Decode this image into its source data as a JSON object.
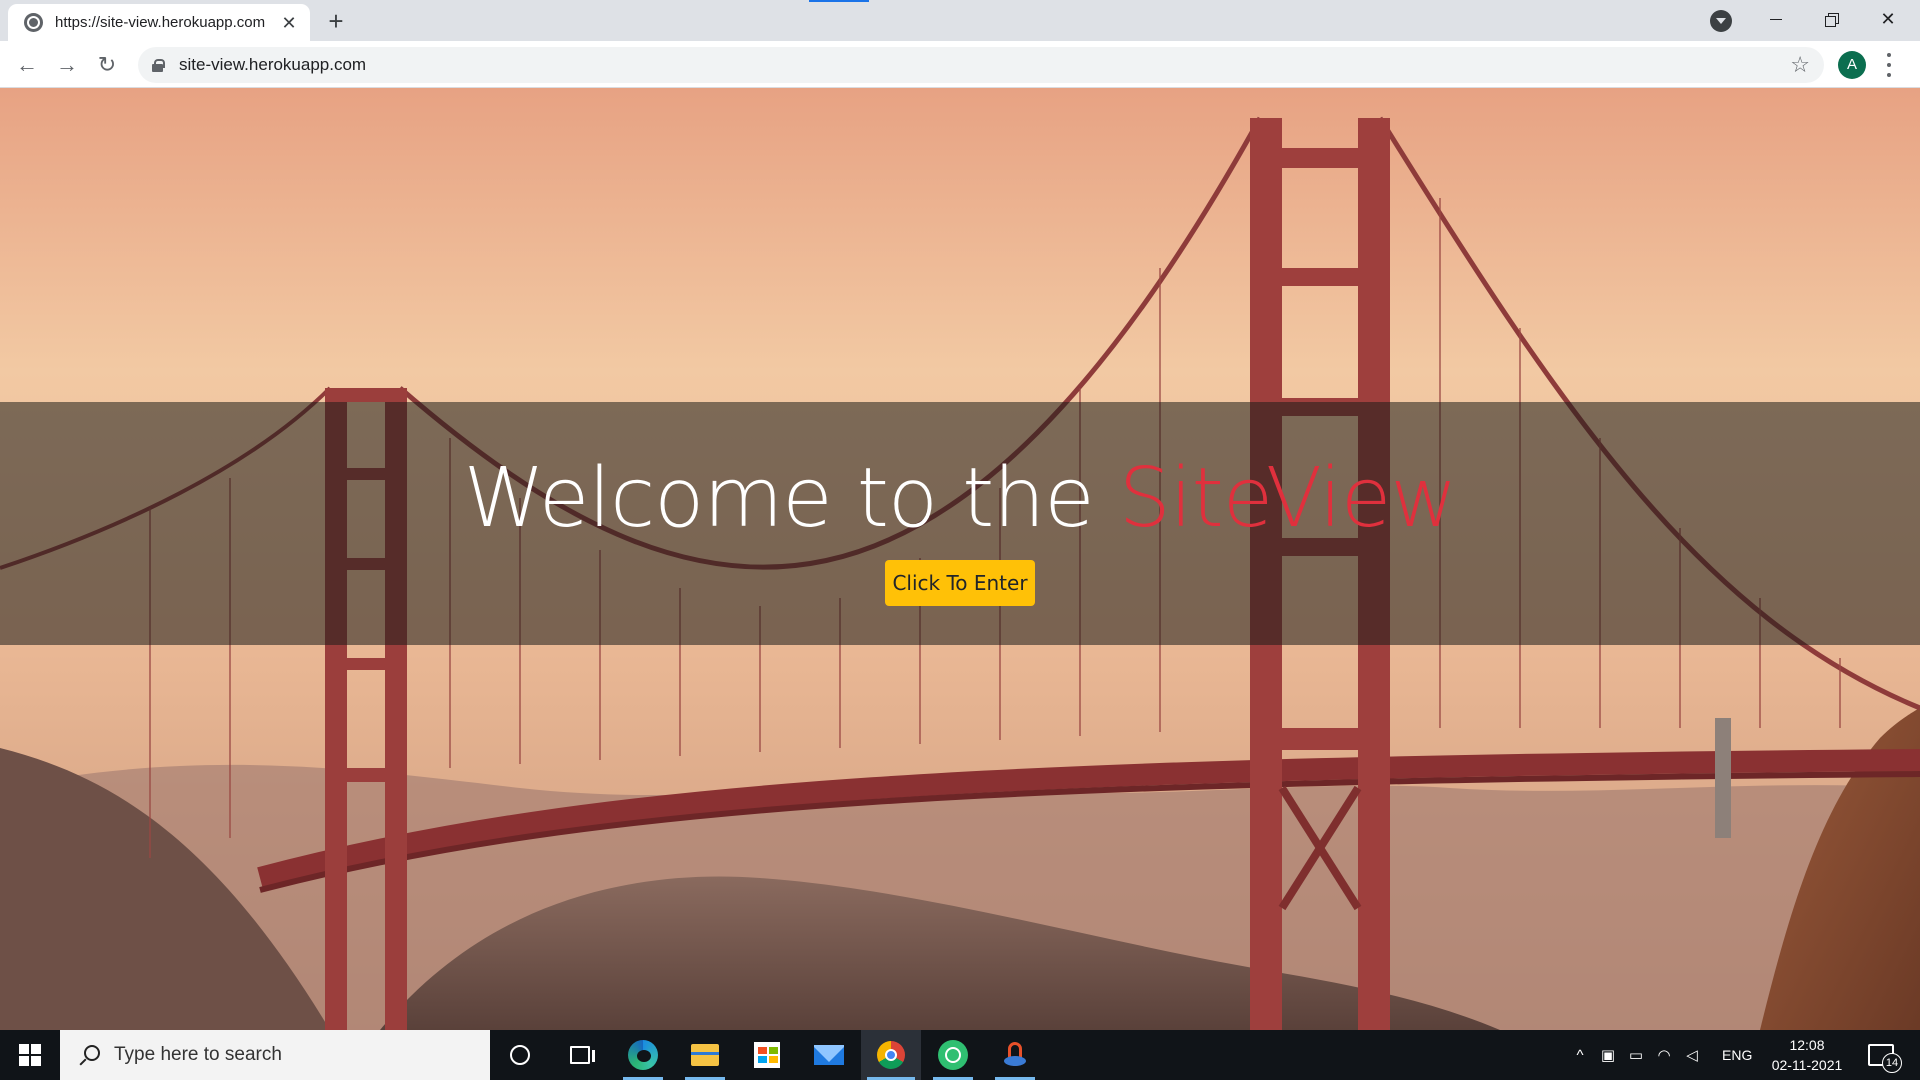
{
  "browser": {
    "tab": {
      "title": "https://site-view.herokuapp.com",
      "favicon": "globe-icon",
      "close_glyph": "✕"
    },
    "new_tab_glyph": "+",
    "address": {
      "url": "site-view.herokuapp.com"
    },
    "nav": {
      "back_glyph": "←",
      "forward_glyph": "→",
      "reload_glyph": "↻"
    },
    "bookmark_glyph": "☆",
    "profile_initial": "A",
    "window_controls": {
      "close_glyph": "✕"
    }
  },
  "page": {
    "heading_prefix": "Welcome to the ",
    "heading_brand": "SiteView",
    "enter_button": "Click To Enter",
    "colors": {
      "brand": "#e0303d",
      "button": "#ffc107",
      "overlay": "rgba(30,30,25,0.55)"
    },
    "background_image": "golden-gate-bridge-sunset"
  },
  "taskbar": {
    "search_placeholder": "Type here to search",
    "pinned": [
      "cortana-icon",
      "task-view-icon",
      "edge-icon",
      "file-explorer-icon",
      "store-icon",
      "mail-icon",
      "chrome-icon",
      "atom-app-icon",
      "snip-tool-icon"
    ],
    "tray": {
      "chevron_glyph": "^",
      "language": "ENG",
      "time": "12:08",
      "date": "02-11-2021",
      "notification_count": "14"
    }
  }
}
